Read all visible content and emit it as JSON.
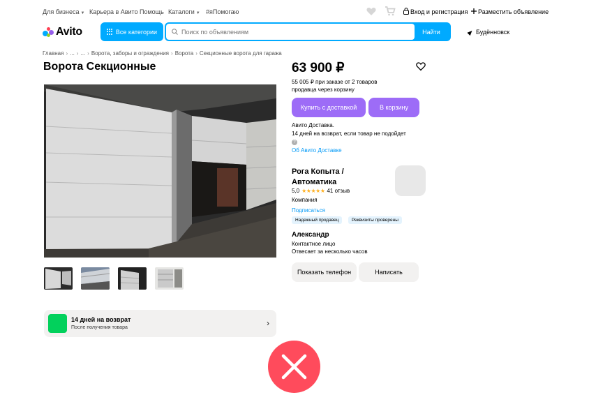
{
  "topbar": {
    "business": "Для бизнеса",
    "careers": "Карьера в Авито",
    "help": "Помощь",
    "catalogs": "Каталоги",
    "ihelp": "#яПомогаю",
    "login": "Вход и регистрация",
    "post_ad": "Разместить объявление"
  },
  "header": {
    "logo_text": "Avito",
    "categories_button": "Все категории",
    "search_placeholder": "Поиск по объявлениям",
    "search_button": "Найти",
    "city": "Будённовск"
  },
  "breadcrumb": [
    "Главная",
    "...",
    "...",
    "Ворота, заборы и ограждения",
    "Ворота",
    "Секционные ворота для гаража"
  ],
  "listing": {
    "title": "Ворота Секционные",
    "price": "63 900 ₽",
    "bulk_note_1": "55 005 ₽ при заказе от 2 товаров",
    "bulk_note_2": "продавца через корзину",
    "buy_button": "Купить с доставкой",
    "cart_button": "В корзину",
    "delivery_1": "Авито Доставка.",
    "delivery_2": "14 дней на возврат, если товар не подойдет",
    "delivery_help_glyph": "?",
    "about_delivery": "Об Авито Доставке"
  },
  "seller": {
    "name": "Рога Копыта / Автоматика",
    "rating": "5,0",
    "stars": "★★★★★",
    "reviews": "41 отзыв",
    "type": "Компания",
    "subscribe": "Подписаться",
    "badges": [
      "Надежный продавец",
      "Реквизиты проверены"
    ],
    "contact_name": "Александр",
    "contact_role": "Контактное лицо",
    "reply_time": "Отвесает за несколько часов",
    "show_phone_button": "Показать телефон",
    "write_button": "Написать"
  },
  "return_banner": {
    "title": "14 дней на возврат",
    "subtitle": "После получения товара"
  },
  "colors": {
    "accent_blue": "#00aaff",
    "purple": "#9d6cf7",
    "link_blue": "#0099f7",
    "green": "#02d15c",
    "close_red": "#ff4b5c",
    "star": "#ffb021"
  },
  "icons": [
    "avito-logo-icon",
    "grid-icon",
    "search-icon",
    "location-arrow-icon",
    "heart-icon",
    "cart-icon",
    "lock-icon",
    "plus-icon",
    "favorite-icon",
    "chevron-right-icon",
    "close-icon"
  ]
}
